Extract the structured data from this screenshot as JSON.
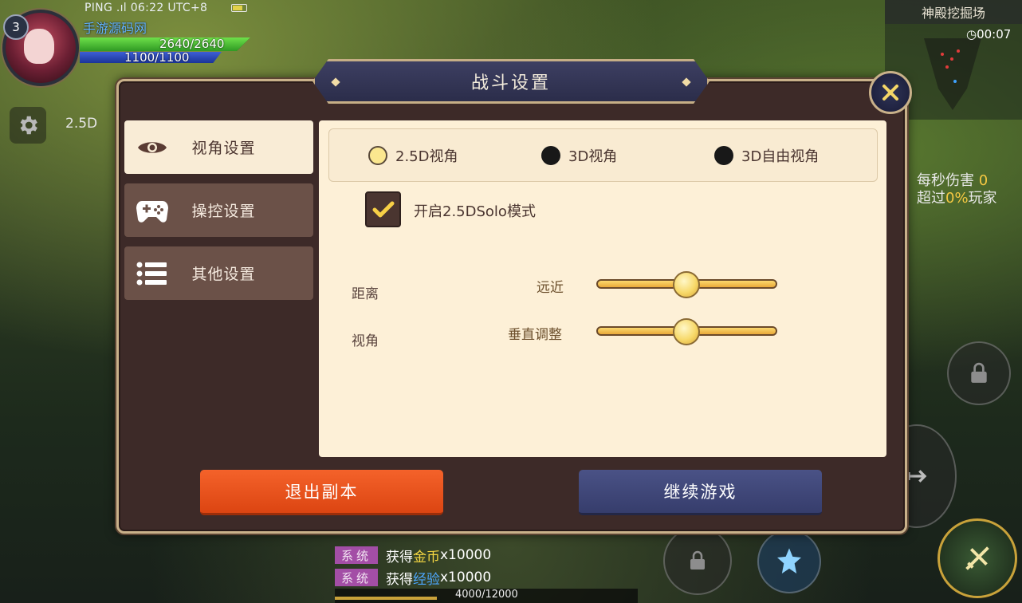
{
  "hud": {
    "level": "3",
    "status": "PING .ıl 06:22 UTC+8",
    "player_name": "手游源码网",
    "hp": "2640/2640",
    "mp": "1100/1100",
    "view_mode": "2.5D",
    "map_name": "神殿挖掘场",
    "timer": "00:07",
    "dps_label": "每秒伤害",
    "dps_value": "0",
    "exceed_prefix": "超过",
    "exceed_value": "0%",
    "exceed_suffix": "玩家"
  },
  "chat": {
    "rows": [
      {
        "tag": "系统",
        "prefix": "获得",
        "item": "金币",
        "amount": "x10000"
      },
      {
        "tag": "系统",
        "prefix": "获得",
        "item": "经验",
        "amount": "x10000"
      }
    ],
    "xp": "4000/12000",
    "xp_fraction": 0.333
  },
  "dialog": {
    "title": "战斗设置",
    "tabs": [
      {
        "label": "视角设置",
        "icon": "eye-icon",
        "active": true
      },
      {
        "label": "操控设置",
        "icon": "gamepad-icon",
        "active": false
      },
      {
        "label": "其他设置",
        "icon": "list-icon",
        "active": false
      }
    ],
    "view_modes": [
      {
        "label": "2.5D视角",
        "selected": true
      },
      {
        "label": "3D视角",
        "selected": false
      },
      {
        "label": "3D自由视角",
        "selected": false
      }
    ],
    "solo_checkbox": {
      "label": "开启2.5DSolo模式",
      "checked": true
    },
    "sliders": [
      {
        "row_label": "距离",
        "name": "远近",
        "value": 0.5
      },
      {
        "row_label": "视角",
        "name": "垂直调整",
        "value": 0.5
      }
    ],
    "exit_button": "退出副本",
    "continue_button": "继续游戏"
  },
  "colors": {
    "accent_gold": "#c9b18a",
    "exit_orange": "#f4622a",
    "continue_navy": "#4a5286",
    "panel_cream": "#fdf0d7"
  }
}
